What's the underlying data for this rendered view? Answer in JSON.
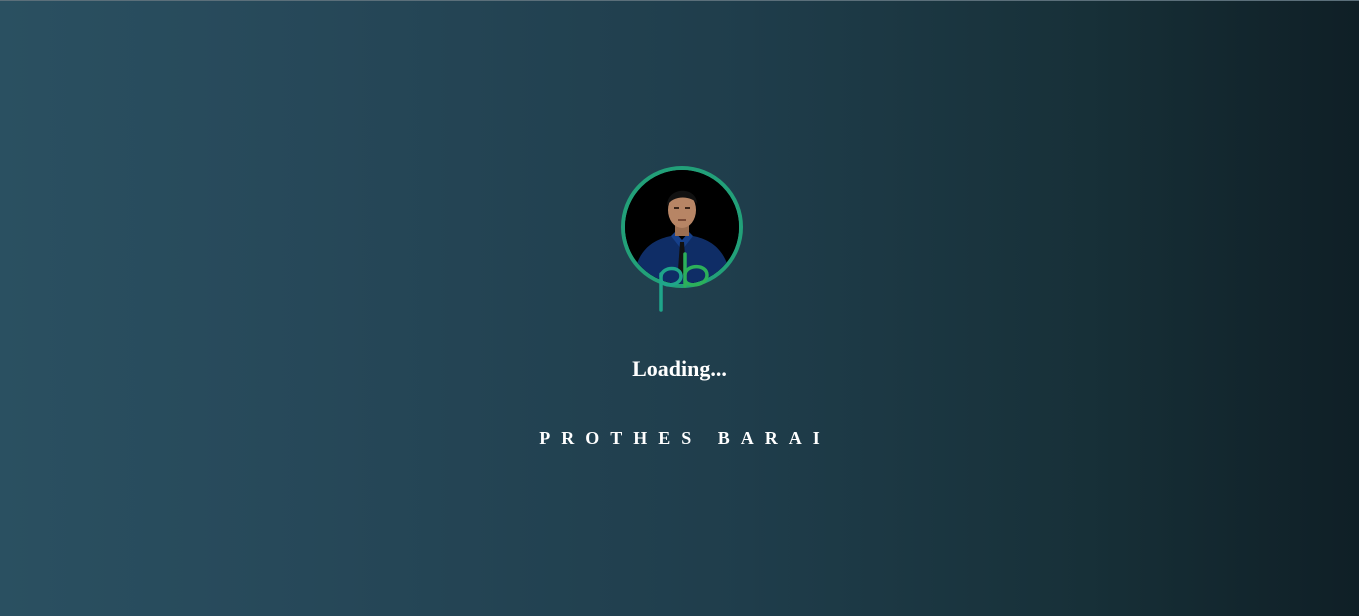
{
  "loader": {
    "status_text": "Loading...",
    "name_text": "PROTHES BARAI",
    "avatar_icon": "profile-photo",
    "logo_icon": "pb-monogram-icon"
  },
  "colors": {
    "ring": "#22a079",
    "text": "#ffffff",
    "background_left": "#2a5061",
    "background_right": "#0f1f26"
  }
}
